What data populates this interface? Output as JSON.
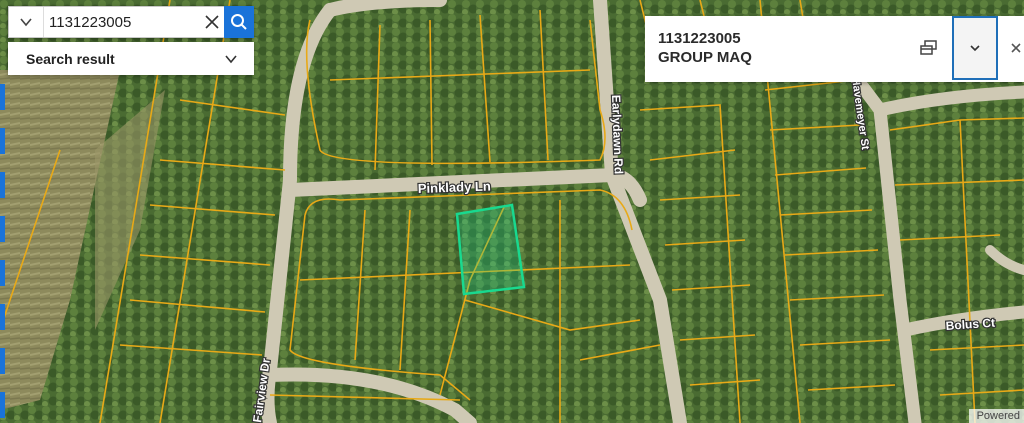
{
  "search": {
    "value": "1131223005",
    "result_label": "Search result"
  },
  "popup": {
    "parcel_id": "1131223005",
    "owner": "GROUP MAQ"
  },
  "map": {
    "roads": {
      "pinklady": "Pinklady Ln",
      "earlydawn": "Earlydawn Rd",
      "havemeyer": "Havemeyer St",
      "bolus": "Bolus Ct",
      "fairview": "Fairview Dr"
    },
    "attribution": "Powered"
  },
  "colors": {
    "accent": "#1a73d9",
    "parcel_line": "#e8a917",
    "selected_parcel": "#19d98f",
    "popup_border": "#1f6fb8"
  },
  "icons": {
    "search_dropdown": "chevron-down-icon",
    "clear": "close-icon",
    "search": "search-icon",
    "result_toggle": "chevron-down-icon",
    "dock": "dock-icon",
    "collapse": "chevron-down-icon",
    "close": "close-icon"
  }
}
